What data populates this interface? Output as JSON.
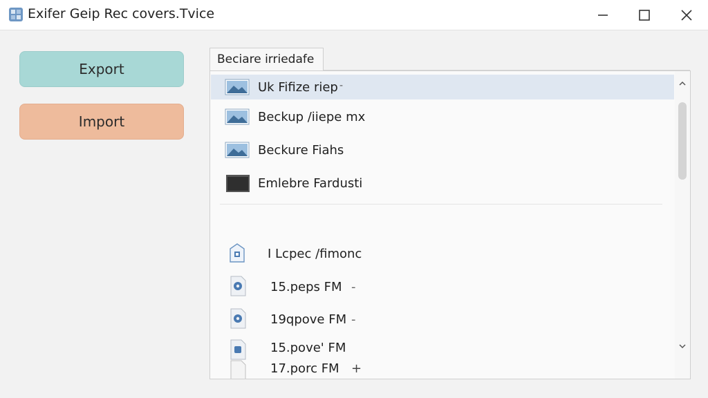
{
  "window": {
    "title": "Exifer  Geip Rec covers.Tvice",
    "app_icon": "app-logo-icon",
    "controls": {
      "minimize_icon": "minimize-icon",
      "maximize_icon": "maximize-icon",
      "close_icon": "close-icon"
    }
  },
  "sidebar": {
    "export_label": "Export",
    "import_label": "Import",
    "export_color": "#a8d8d6",
    "import_color": "#eebb9c"
  },
  "tab": {
    "label": "Beciare irriedafe"
  },
  "file_list": {
    "selected_color": "#dfe7f1",
    "items": [
      {
        "label": "Uk Fifize riep",
        "suffix": "-",
        "icon": "image-icon",
        "selected": true
      },
      {
        "label": "Beckup /iiepe mx",
        "suffix": "",
        "icon": "image-icon",
        "selected": false
      },
      {
        "label": "Beckure Fiahs",
        "suffix": "",
        "icon": "image-icon",
        "selected": false
      },
      {
        "label": "Emlebre Fardusti",
        "suffix": "",
        "icon": "folder-icon",
        "selected": false
      },
      {
        "label": "I Lcpec /fimonc",
        "suffix": "",
        "icon": "home-file-icon",
        "selected": false
      },
      {
        "label": "15.peps  FM",
        "suffix": "-",
        "icon": "gear-file-icon",
        "selected": false
      },
      {
        "label": "19qpove  FM",
        "suffix": "-",
        "icon": "gear-file-icon",
        "selected": false
      },
      {
        "label": "15.pove' FM",
        "suffix": "",
        "icon": "doc-file-icon",
        "selected": false
      },
      {
        "label": "17.porc  FM",
        "suffix": "+",
        "icon": "blank-file-icon",
        "selected": false
      }
    ]
  },
  "scrollbar": {
    "up_icon": "chevron-up-icon",
    "down_icon": "chevron-down-icon"
  }
}
